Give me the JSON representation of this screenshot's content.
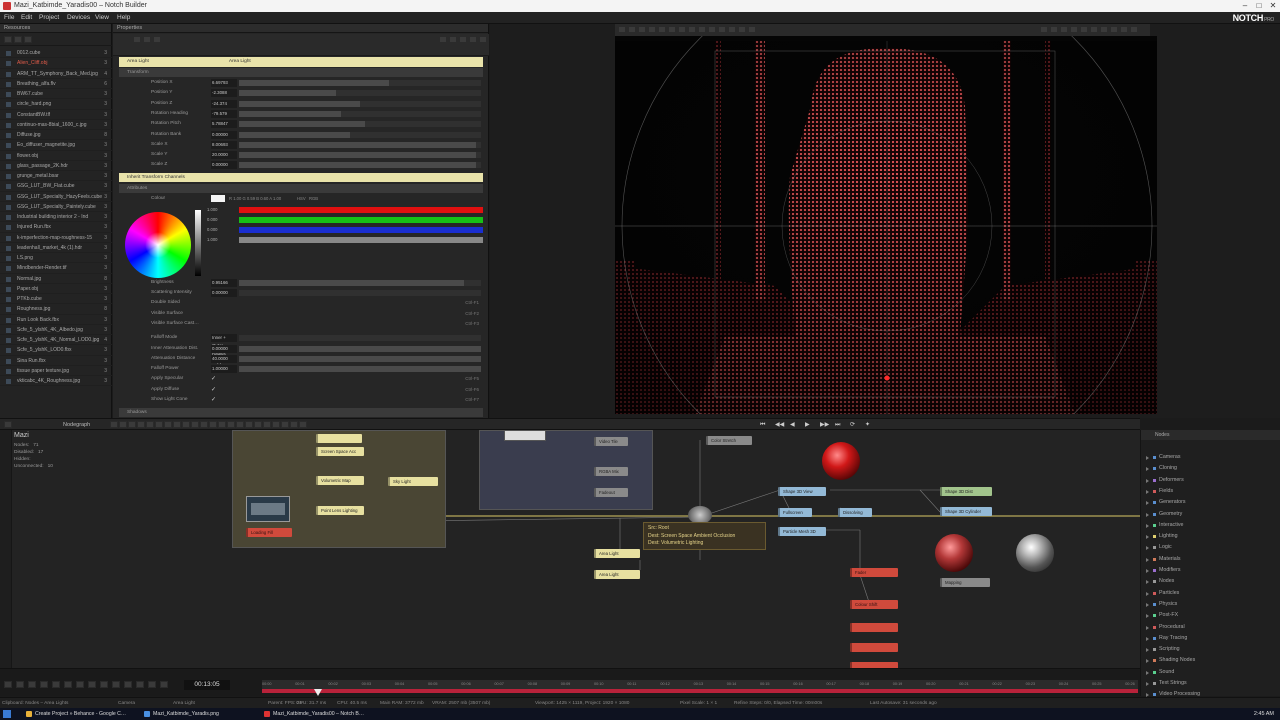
{
  "window": {
    "title": "Mazi_Katbimde_Yaradis00 – Notch Builder",
    "min": "–",
    "max": "□",
    "close": "✕"
  },
  "menu": [
    "File",
    "Edit",
    "Project",
    "Devices",
    "View",
    "Help"
  ],
  "brand": {
    "name": "NOTCH",
    "edition": "PRO"
  },
  "resources": {
    "title": "Resources",
    "items": [
      {
        "name": "0012.cube",
        "n": "3"
      },
      {
        "name": "Alien_Cliff.obj",
        "n": "3",
        "sel": true
      },
      {
        "name": "ARM_TT_Symphony_Back_Med.jpg",
        "n": "4"
      },
      {
        "name": "Breathing_alfa.flv",
        "n": "6"
      },
      {
        "name": "BW67.cube",
        "n": "3"
      },
      {
        "name": "circle_hard.png",
        "n": "3"
      },
      {
        "name": "ConstantBW.tlf",
        "n": "3"
      },
      {
        "name": "continuo-mas-8bial_1600_c.jpg",
        "n": "3"
      },
      {
        "name": "Diffuse.jpg",
        "n": "8"
      },
      {
        "name": "Eo_diffuser_magnetite.jpg",
        "n": "3"
      },
      {
        "name": "flower.obj",
        "n": "3"
      },
      {
        "name": "glass_passage_2K.hdr",
        "n": "3"
      },
      {
        "name": "grunge_metal.bsar",
        "n": "3"
      },
      {
        "name": "GSG_LUT_BW_Flat.cube",
        "n": "3"
      },
      {
        "name": "GSG_LUT_Specialty_HazyFeels.cube",
        "n": "3"
      },
      {
        "name": "GSG_LUT_Specialty_Paintely.cube",
        "n": "3"
      },
      {
        "name": "Industrial building interior 2 - Ind",
        "n": "3"
      },
      {
        "name": "Injured Run.fbx",
        "n": "3"
      },
      {
        "name": "k-imperfection-map-roughness-15",
        "n": "3"
      },
      {
        "name": "leadenhall_market_4k (1).hdr",
        "n": "3"
      },
      {
        "name": "LS.png",
        "n": "3"
      },
      {
        "name": "Mindbender-Render.tif",
        "n": "3"
      },
      {
        "name": "Normal.jpg",
        "n": "8"
      },
      {
        "name": "Paper.obj",
        "n": "3"
      },
      {
        "name": "PTKb.cube",
        "n": "3"
      },
      {
        "name": "Roughness.jpg",
        "n": "8"
      },
      {
        "name": "Run Look Back.fbx",
        "n": "3"
      },
      {
        "name": "Scfe_5_ylshK_4K_Albedo.jpg",
        "n": "3"
      },
      {
        "name": "Scfe_5_ylshK_4K_Normal_LOD0.jpg",
        "n": "4"
      },
      {
        "name": "Scfe_5_ylshK_LOD0.fbx",
        "n": "3"
      },
      {
        "name": "Sina Run.fbx",
        "n": "3"
      },
      {
        "name": "tissue paper texture.jpg",
        "n": "3"
      },
      {
        "name": "vkticabc_4K_Roughness.jpg",
        "n": "3"
      }
    ]
  },
  "properties": {
    "title": "Properties",
    "node_type": "Area Light",
    "node_name": "Area Light",
    "sections": {
      "transform": "Transform",
      "inherit": "Inherit Transform Channels",
      "attributes": "Attributes",
      "shadows": "Shadows"
    },
    "transform": [
      {
        "label": "Position X",
        "value": "6.69793",
        "fill": 0.62
      },
      {
        "label": "Position Y",
        "value": "-2.3088",
        "fill": 0.4
      },
      {
        "label": "Position Z",
        "value": "-24.374",
        "fill": 0.5
      },
      {
        "label": "Rotation Heading",
        "value": "-79.579",
        "fill": 0.42
      },
      {
        "label": "Rotation Pitch",
        "value": "5.78847",
        "fill": 0.52
      },
      {
        "label": "Rotation Bank",
        "value": "0.00000",
        "fill": 0.46
      },
      {
        "label": "Scale X",
        "value": "8.00693",
        "fill": 0.98
      },
      {
        "label": "Scale Y",
        "value": "20.0000",
        "fill": 0.98
      },
      {
        "label": "Scale Z",
        "value": "0.00000",
        "fill": 0.98
      }
    ],
    "colour": {
      "label": "Colour",
      "hex": "R 1.00  G 0.59  B 0.60  A 1.00",
      "r": "1.000",
      "g": "0.000",
      "b": "0.000",
      "a": "1.000",
      "modes": [
        "HSV",
        "RGB"
      ]
    },
    "attributes": [
      {
        "label": "Brightness",
        "value": "0.95166",
        "fill": 0.93
      },
      {
        "label": "Scattering Intensity",
        "value": "0.00000",
        "fill": 0
      }
    ],
    "toggles": [
      {
        "label": "Double Sided",
        "checked": false,
        "shortcut": "Ctrl-F1"
      },
      {
        "label": "Visible Surface",
        "checked": false,
        "shortcut": "Ctrl-F2"
      },
      {
        "label": "Visible Surface Cast…",
        "checked": false,
        "shortcut": "Ctrl-F3"
      }
    ],
    "falloff": [
      {
        "label": "Falloff Mode",
        "value": "Inner + Outer Radius Support",
        "fill": 0
      },
      {
        "label": "Inner Attenuation Dist.",
        "value": "0.00000",
        "fill": 1
      },
      {
        "label": "Attenuation Distance",
        "value": "40.0000",
        "fill": 1
      },
      {
        "label": "Falloff Power",
        "value": "1.00000",
        "fill": 1
      }
    ],
    "checks": [
      {
        "label": "Apply Specular",
        "checked": true,
        "shortcut": "Ctrl-F5"
      },
      {
        "label": "Apply Diffuse",
        "checked": true,
        "shortcut": "Ctrl-F6"
      },
      {
        "label": "Show Light Cone",
        "checked": true,
        "shortcut": "Ctrl-F7"
      }
    ]
  },
  "nodegraph": {
    "tab": "Nodegraph",
    "layer": "Mazi",
    "stats": [
      {
        "k": "Nodes:",
        "v": "71"
      },
      {
        "k": "Disabled:",
        "v": "17"
      },
      {
        "k": "Hidden:",
        "v": ""
      },
      {
        "k": "Unconnected:",
        "v": "10"
      }
    ],
    "nodes": [
      {
        "label": "",
        "cls": "n-y"
      },
      {
        "label": "Screen Space Acc",
        "cls": "n-y"
      },
      {
        "label": "Volumetric Map",
        "cls": "n-y"
      },
      {
        "label": "Sky Light",
        "cls": "n-y"
      },
      {
        "label": "Point Lens Lighting",
        "cls": "n-y"
      },
      {
        "label": "Loading Fill",
        "cls": "n-r"
      },
      {
        "label": "Video Tile",
        "cls": "n-gr"
      },
      {
        "label": "RGBA Mix",
        "cls": "n-gr"
      },
      {
        "label": "Fadeout",
        "cls": "n-gr"
      },
      {
        "label": "Color Stretch",
        "cls": "n-gr"
      },
      {
        "label": "Shape 3D View",
        "cls": "n-b"
      },
      {
        "label": "Fullscreen",
        "cls": "n-b"
      },
      {
        "label": "Dissolving",
        "cls": "n-b"
      },
      {
        "label": "Shape 3D Dist",
        "cls": "n-g"
      },
      {
        "label": "Shape 3D Cylinder",
        "cls": "n-b"
      },
      {
        "label": "Particle Mesh 3D",
        "cls": "n-b"
      },
      {
        "label": "Area Light",
        "cls": "n-y"
      },
      {
        "label": "Area Light",
        "cls": "n-y"
      },
      {
        "label": "Mapping",
        "cls": "n-gr"
      },
      {
        "label": "Fader",
        "cls": "n-r"
      },
      {
        "label": "Colour Shift",
        "cls": "n-r"
      },
      {
        "label": "",
        "cls": "n-r"
      },
      {
        "label": "",
        "cls": "n-r"
      },
      {
        "label": "",
        "cls": "n-r"
      }
    ],
    "tooltip": {
      "src": "Src: Root",
      "dest1": "Dest: Screen Space Ambient Occlusion",
      "dest2": "Dest: Volumetric Lighting"
    }
  },
  "library": {
    "title": "Nodes",
    "items": [
      {
        "label": "Cameras",
        "dot": "#5a8fd0"
      },
      {
        "label": "Cloning",
        "dot": "#5a8fd0"
      },
      {
        "label": "Deformers",
        "dot": "#9b6fd0"
      },
      {
        "label": "Fields",
        "dot": "#d05a5a"
      },
      {
        "label": "Generators",
        "dot": "#5a8fd0"
      },
      {
        "label": "Geometry",
        "dot": "#5a8fd0"
      },
      {
        "label": "Interactive",
        "dot": "#5ad08f"
      },
      {
        "label": "Lighting",
        "dot": "#e0d070"
      },
      {
        "label": "Logic",
        "dot": "#999999"
      },
      {
        "label": "Materials",
        "dot": "#d07a5a"
      },
      {
        "label": "Modifiers",
        "dot": "#9b6fd0"
      },
      {
        "label": "Nodes",
        "dot": "#999999"
      },
      {
        "label": "Particles",
        "dot": "#d05a5a"
      },
      {
        "label": "Physics",
        "dot": "#5a8fd0"
      },
      {
        "label": "Post-FX",
        "dot": "#5ad08f"
      },
      {
        "label": "Procedural",
        "dot": "#d05a5a"
      },
      {
        "label": "Ray Tracing",
        "dot": "#5a8fd0"
      },
      {
        "label": "Scripting",
        "dot": "#999999"
      },
      {
        "label": "Shading Nodes",
        "dot": "#d07a5a"
      },
      {
        "label": "Sound",
        "dot": "#5ad08f"
      },
      {
        "label": "Text Strings",
        "dot": "#999999"
      },
      {
        "label": "Video Processing",
        "dot": "#5a8fd0"
      }
    ]
  },
  "timeline": {
    "timecode": "00:13:05",
    "ticks": [
      "00:00",
      "00:01",
      "00:02",
      "00:03",
      "00:04",
      "00:05",
      "00:06",
      "00:07",
      "00:08",
      "00:09",
      "00:10",
      "00:11",
      "00:12",
      "00:13",
      "00:14",
      "00:15",
      "00:16",
      "00:17",
      "00:18",
      "00:19",
      "00:20",
      "00:21",
      "00:22",
      "00:23",
      "00:24",
      "00:25",
      "00:26"
    ]
  },
  "status": [
    "Clipboard: Nodes – Area Lights",
    "Camera",
    "Area Light",
    "Parent: FPS: 25",
    "GPU: 31.7 ms",
    "CPU: 40.5 ms",
    "Main RAM: 3772 mb",
    "VRAM: 2507 mb (3507 mb)",
    "Viewport: 1425 × 1119, Project: 1920 × 1080",
    "Pixel Scale: 1 × 1",
    "Refine Steps: 0/0, Elapsed Time: 00m00s",
    "Last Autosave: 31 seconds ago"
  ],
  "taskbar": [
    {
      "label": "Create Project » Behance - Google C…",
      "color": "#e8b13a"
    },
    {
      "label": "Mazi_Katbimde_Yaradis.png",
      "color": "#4a90e2"
    },
    {
      "label": "Mazi_Katbimde_Yaradis00 – Notch B…",
      "color": "#d33"
    }
  ],
  "clock": "2:45 AM",
  "colors": {
    "accent_red": "#b8223a",
    "light_yellow": "#e9e3aa",
    "particle_red": "#e04848"
  }
}
